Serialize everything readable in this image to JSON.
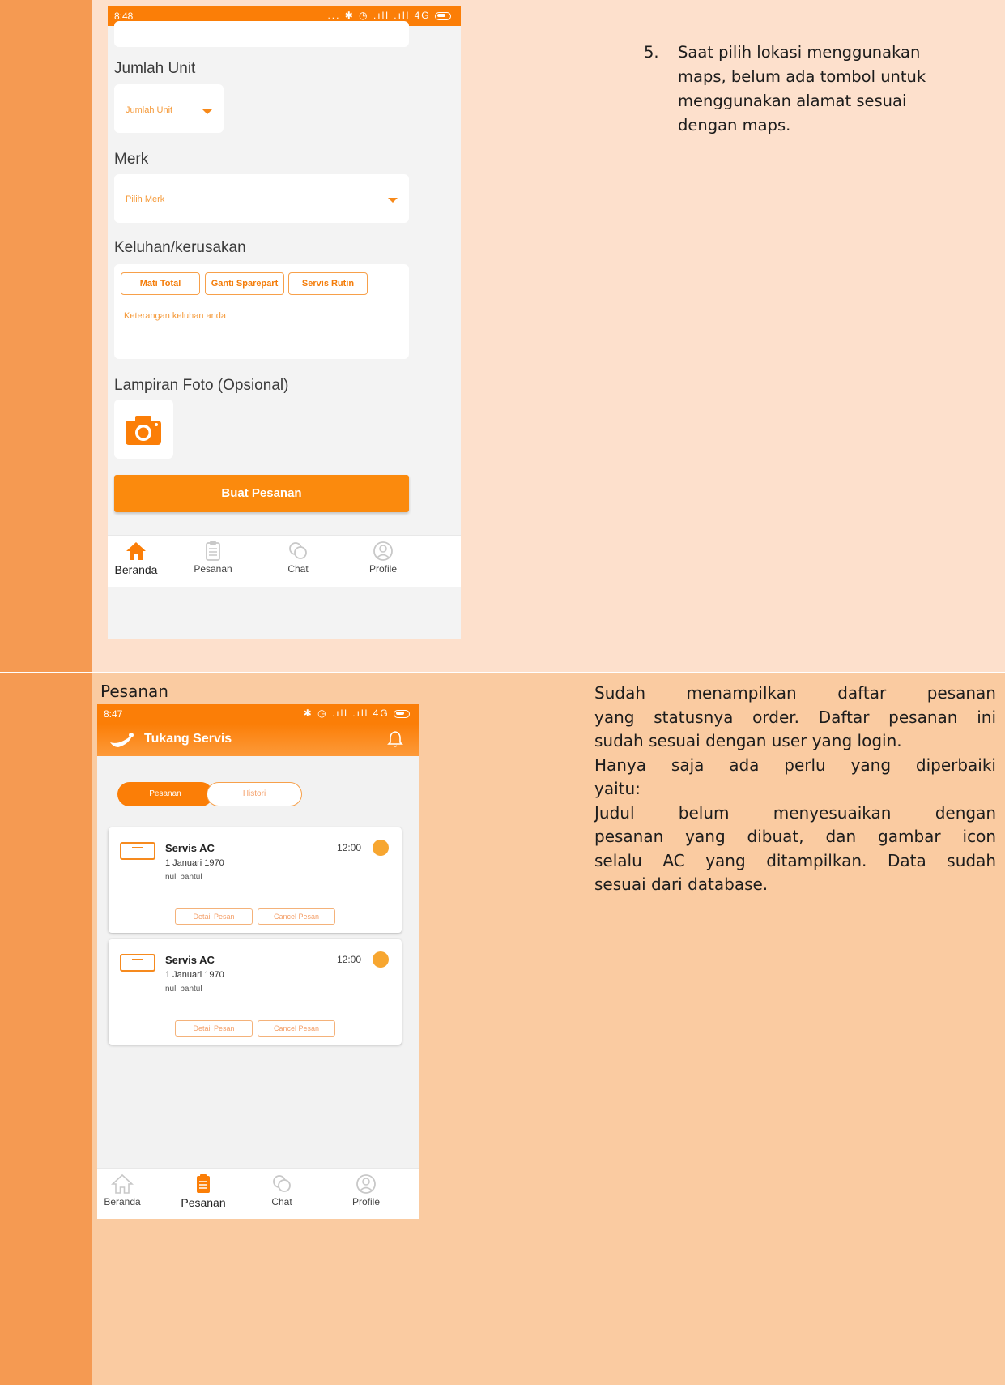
{
  "colors": {
    "left_column": "#f59a52",
    "top_row_bg": "#fde0cc",
    "bottom_row_bg": "#facba1",
    "accent": "#fb7e07"
  },
  "row1": {
    "phone": {
      "status_time": "8:48",
      "status_icons": "... ✱ ◷ .ıll .ıll 4G",
      "jumlah_unit_label": "Jumlah Unit",
      "jumlah_unit_placeholder": "Jumlah Unit",
      "merk_label": "Merk",
      "merk_placeholder": "Pilih Merk",
      "keluhan_label": "Keluhan/kerusakan",
      "chips": [
        "Mati Total",
        "Ganti Sparepart",
        "Servis Rutin"
      ],
      "keluhan_placeholder": "Keterangan keluhan anda",
      "lampiran_label": "Lampiran Foto (Opsional)",
      "camera_icon": "camera-icon",
      "submit_label": "Buat Pesanan",
      "nav": [
        {
          "label": "Beranda",
          "icon": "home-icon",
          "active": true
        },
        {
          "label": "Pesanan",
          "icon": "clipboard-icon",
          "active": false
        },
        {
          "label": "Chat",
          "icon": "chat-icon",
          "active": false
        },
        {
          "label": "Profile",
          "icon": "profile-icon",
          "active": false
        }
      ]
    },
    "note_number": "5.",
    "note_text": "Saat pilih lokasi menggunakan maps, belum ada tombol untuk menggunakan alamat sesuai dengan maps."
  },
  "row2": {
    "section_label": "Pesanan",
    "phone": {
      "status_time": "8:47",
      "status_icons": "✱ ◷ .ıll .ıll 4G",
      "app_title": "Tukang Servis",
      "bell_icon": "bell-icon",
      "tab_pesanan": "Pesanan",
      "tab_histori": "Histori",
      "cards": [
        {
          "title": "Servis AC",
          "date": "1 Januari 1970",
          "address": "null bantul",
          "time": "12:00",
          "detail_label": "Detail Pesan",
          "cancel_label": "Cancel Pesan"
        },
        {
          "title": "Servis AC",
          "date": "1 Januari 1970",
          "address": "null bantul",
          "time": "12:00",
          "detail_label": "Detail Pesan",
          "cancel_label": "Cancel Pesan"
        }
      ],
      "nav": [
        {
          "label": "Beranda",
          "icon": "home-icon",
          "active": false
        },
        {
          "label": "Pesanan",
          "icon": "clipboard-icon",
          "active": true
        },
        {
          "label": "Chat",
          "icon": "chat-icon",
          "active": false
        },
        {
          "label": "Profile",
          "icon": "profile-icon",
          "active": false
        }
      ]
    },
    "note_lines": [
      "Sudah menampilkan daftar pesanan",
      "yang statusnya order. Daftar pesanan ini",
      "sudah sesuai dengan user yang login.",
      "Hanya saja ada perlu yang diperbaiki",
      "yaitu:",
      "Judul belum menyesuaikan dengan",
      "pesanan yang dibuat, dan gambar icon",
      "selalu AC yang ditampilkan. Data sudah",
      "sesuai dari database."
    ]
  }
}
